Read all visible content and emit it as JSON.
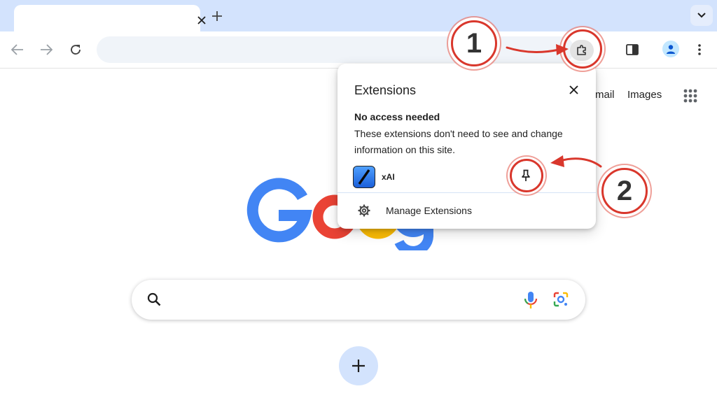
{
  "extensions_popup": {
    "title": "Extensions",
    "section_heading": "No access needed",
    "section_description": "These extensions don't need to see and change information on this site.",
    "extension_name": "xAI",
    "manage_label": "Manage Extensions"
  },
  "page": {
    "links": [
      "mail",
      "Images"
    ]
  },
  "annotations": {
    "step1": "1",
    "step2": "2"
  },
  "colors": {
    "annotation": "#d9372c",
    "tabstrip": "#d3e3fd",
    "google_blue": "#4285f4",
    "google_red": "#ea4335",
    "google_yellow": "#fbbc05",
    "google_green": "#34a853"
  }
}
